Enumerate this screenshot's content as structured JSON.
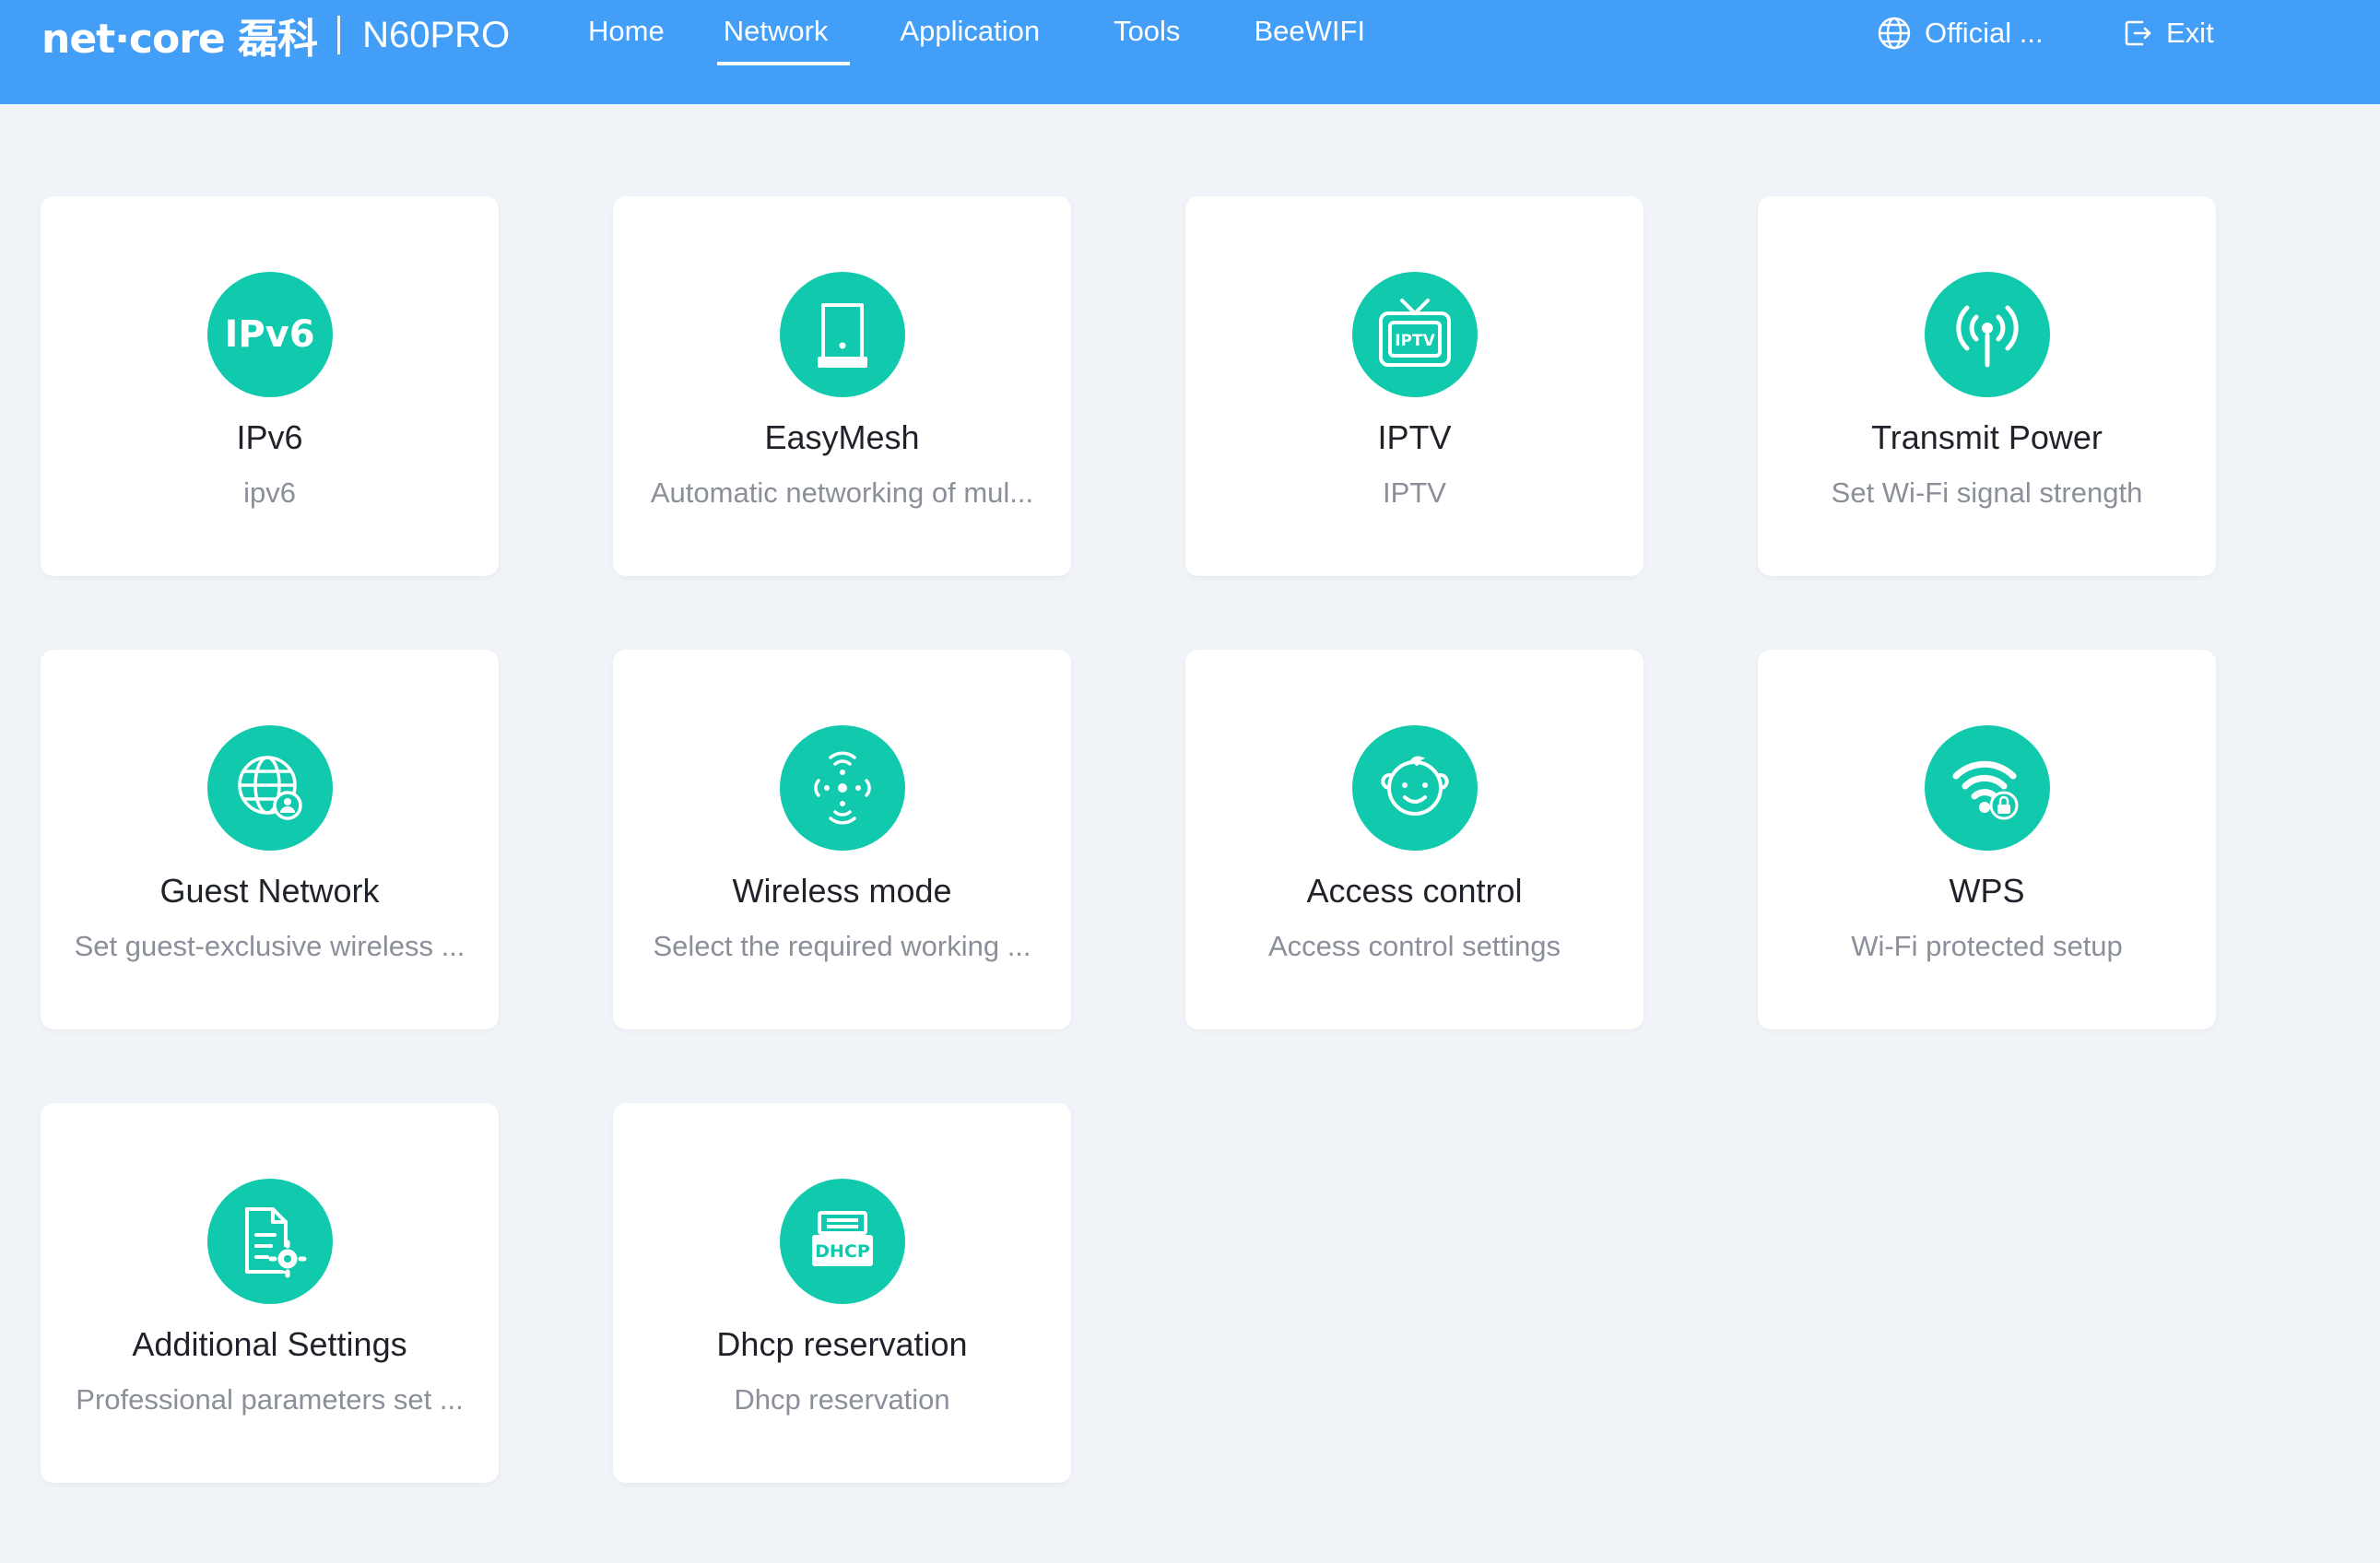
{
  "header": {
    "brand_logo": "net·core 磊科",
    "model": "N60PRO",
    "nav": [
      {
        "label": "Home",
        "active": false
      },
      {
        "label": "Network",
        "active": true
      },
      {
        "label": "Application",
        "active": false
      },
      {
        "label": "Tools",
        "active": false
      },
      {
        "label": "BeeWIFI",
        "active": false
      }
    ],
    "official_label": "Official ...",
    "exit_label": "Exit"
  },
  "colors": {
    "header_bg": "#439ef8",
    "accent": "#11c9ad",
    "page_bg": "#f0f3f7"
  },
  "cards": [
    {
      "icon": "ipv6-icon",
      "icon_text": "IPv6",
      "title": "IPv6",
      "desc": "ipv6"
    },
    {
      "icon": "easymesh-icon",
      "title": "EasyMesh",
      "desc": "Automatic networking of mul..."
    },
    {
      "icon": "tv-icon",
      "icon_text": "IPTV",
      "title": "IPTV",
      "desc": "IPTV"
    },
    {
      "icon": "signal-tower-icon",
      "title": "Transmit Power",
      "desc": "Set Wi-Fi signal strength"
    },
    {
      "icon": "globe-user-icon",
      "title": "Guest Network",
      "desc": "Set guest-exclusive wireless ..."
    },
    {
      "icon": "wireless-mode-icon",
      "title": "Wireless mode",
      "desc": "Select the required working ..."
    },
    {
      "icon": "baby-face-icon",
      "title": "Access control",
      "desc": "Access control settings"
    },
    {
      "icon": "wifi-lock-icon",
      "title": "WPS",
      "desc": "Wi-Fi protected setup"
    },
    {
      "icon": "document-gear-icon",
      "title": "Additional Settings",
      "desc": "Professional parameters set ..."
    },
    {
      "icon": "dhcp-icon",
      "icon_text": "DHCP",
      "title": "Dhcp reservation",
      "desc": "Dhcp reservation"
    }
  ]
}
